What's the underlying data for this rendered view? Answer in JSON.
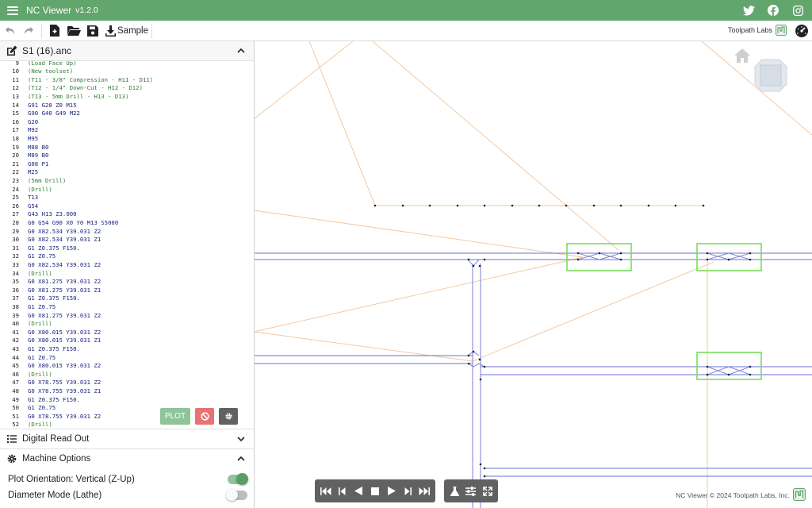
{
  "app": {
    "title": "NC Viewer",
    "version": "v1.2.0",
    "social": [
      "twitter-icon",
      "facebook-icon",
      "instagram-icon"
    ]
  },
  "toolbar": {
    "sample_label": "Sample",
    "brand_label": "Toolpath Labs"
  },
  "file": {
    "name": "S1 (16).anc"
  },
  "code_lines": [
    {
      "n": "9",
      "t": "(Load Face Up)",
      "k": "comment"
    },
    {
      "n": "10",
      "t": "(New toolset)",
      "k": "comment"
    },
    {
      "n": "11",
      "t": "(T11 - 3/8\" Compression - H11 - D11)",
      "k": "comment"
    },
    {
      "n": "12",
      "t": "(T12 - 1/4\" Down-Cut - H12 - D12)",
      "k": "comment"
    },
    {
      "n": "13",
      "t": "(T13 - 5mm Drill - H13 - D13)",
      "k": "comment"
    },
    {
      "n": "14",
      "t": "G91 G28 Z0 M15",
      "k": "code"
    },
    {
      "n": "15",
      "t": "G90 G40 G49 M22",
      "k": "code"
    },
    {
      "n": "16",
      "t": "G20",
      "k": "code"
    },
    {
      "n": "17",
      "t": "M92",
      "k": "code"
    },
    {
      "n": "18",
      "t": "M95",
      "k": "code"
    },
    {
      "n": "19",
      "t": "M88 B0",
      "k": "code"
    },
    {
      "n": "20",
      "t": "M89 B0",
      "k": "code"
    },
    {
      "n": "21",
      "t": "G08 P1",
      "k": "code"
    },
    {
      "n": "22",
      "t": "M25",
      "k": "code"
    },
    {
      "n": "23",
      "t": "(5mm Drill)",
      "k": "comment"
    },
    {
      "n": "24",
      "t": "(Drill)",
      "k": "comment"
    },
    {
      "n": "25",
      "t": "T13",
      "k": "code"
    },
    {
      "n": "26",
      "t": "G54",
      "k": "code"
    },
    {
      "n": "27",
      "t": "G43 H13 Z3.000",
      "k": "code"
    },
    {
      "n": "28",
      "t": "G0 G54 G90 X0 Y0 M13 S5000",
      "k": "code"
    },
    {
      "n": "29",
      "t": "G0 X82.534 Y39.031 Z2",
      "k": "code"
    },
    {
      "n": "30",
      "t": "G0 X82.534 Y39.031 Z1",
      "k": "code"
    },
    {
      "n": "31",
      "t": "G1 Z0.375 F150.",
      "k": "code"
    },
    {
      "n": "32",
      "t": "G1 Z0.75",
      "k": "code"
    },
    {
      "n": "33",
      "t": "G0 X82.534 Y39.031 Z2",
      "k": "code"
    },
    {
      "n": "34",
      "t": "(Drill)",
      "k": "comment"
    },
    {
      "n": "35",
      "t": "G0 X81.275 Y39.031 Z2",
      "k": "code"
    },
    {
      "n": "36",
      "t": "G0 X81.275 Y39.031 Z1",
      "k": "code"
    },
    {
      "n": "37",
      "t": "G1 Z0.375 F150.",
      "k": "code"
    },
    {
      "n": "38",
      "t": "G1 Z0.75",
      "k": "code"
    },
    {
      "n": "39",
      "t": "G0 X81.275 Y39.031 Z2",
      "k": "code"
    },
    {
      "n": "40",
      "t": "(Drill)",
      "k": "comment"
    },
    {
      "n": "41",
      "t": "G0 X80.015 Y39.031 Z2",
      "k": "code"
    },
    {
      "n": "42",
      "t": "G0 X80.015 Y39.031 Z1",
      "k": "code"
    },
    {
      "n": "43",
      "t": "G1 Z0.375 F150.",
      "k": "code"
    },
    {
      "n": "44",
      "t": "G1 Z0.75",
      "k": "code"
    },
    {
      "n": "45",
      "t": "G0 X80.015 Y39.031 Z2",
      "k": "code"
    },
    {
      "n": "46",
      "t": "(Drill)",
      "k": "comment"
    },
    {
      "n": "47",
      "t": "G0 X78.755 Y39.031 Z2",
      "k": "code"
    },
    {
      "n": "48",
      "t": "G0 X78.755 Y39.031 Z1",
      "k": "code"
    },
    {
      "n": "49",
      "t": "G1 Z0.375 F150.",
      "k": "code"
    },
    {
      "n": "50",
      "t": "G1 Z0.75",
      "k": "code"
    },
    {
      "n": "51",
      "t": "G0 X78.755 Y39.031 Z2",
      "k": "code"
    },
    {
      "n": "52",
      "t": "(Drill)",
      "k": "comment"
    }
  ],
  "editor_buttons": {
    "plot_label": "PLOT"
  },
  "sections": {
    "dro_label": "Digital Read Out",
    "machine_label": "Machine Options"
  },
  "options": {
    "plot_orientation_label": "Plot Orientation: Vertical (Z-Up)",
    "plot_orientation_on": true,
    "diameter_mode_label": "Diameter Mode (Lathe)",
    "diameter_mode_on": false
  },
  "footer": {
    "copyright": "NC Viewer © 2024 Toolpath Labs, Inc."
  },
  "colors": {
    "titlebar": "#62a56d",
    "rapid": "#f2c49a",
    "feed": "#6b6fd6",
    "highlight": "#74e05a",
    "points": "#222222"
  }
}
